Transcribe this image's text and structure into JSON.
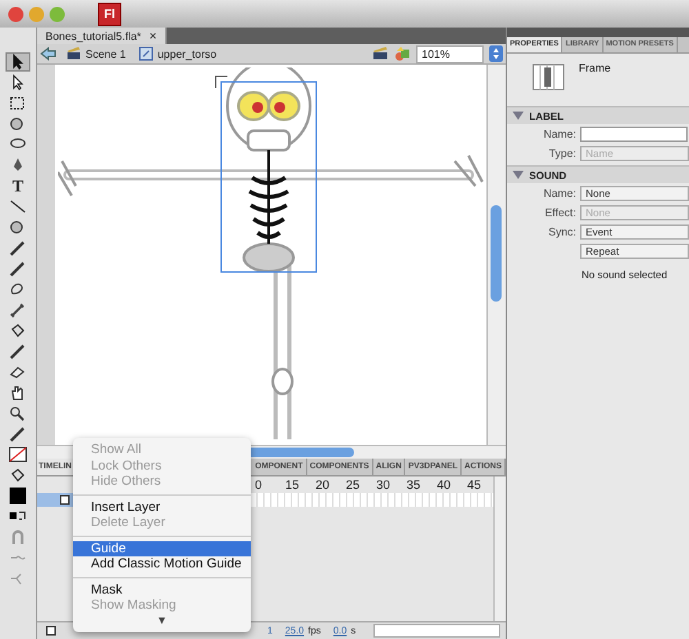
{
  "app_icon": "Fl",
  "document_tab": {
    "title": "Bones_tutorial5.fla*",
    "close": "×"
  },
  "edit_bar": {
    "crumbs": [
      {
        "label": "Scene 1",
        "kind": "scene"
      },
      {
        "label": "upper_torso",
        "kind": "symbol"
      }
    ],
    "zoom": "101%"
  },
  "tools": [
    {
      "kind": "arrow",
      "selected": true
    },
    {
      "kind": "subselect",
      "selected": false
    },
    {
      "kind": "transform",
      "selected": false
    },
    {
      "kind": "sphere",
      "selected": false
    },
    {
      "kind": "lasso",
      "selected": false
    },
    {
      "kind": "pen",
      "selected": false
    },
    {
      "kind": "text",
      "glyph": "T",
      "selected": false
    },
    {
      "kind": "line",
      "selected": false
    },
    {
      "kind": "oval",
      "selected": false
    },
    {
      "kind": "pencil",
      "selected": false
    },
    {
      "kind": "brush",
      "selected": false
    },
    {
      "kind": "deco",
      "selected": false
    },
    {
      "kind": "bone",
      "selected": false
    },
    {
      "kind": "bucket",
      "selected": false
    },
    {
      "kind": "eyedropper",
      "selected": false
    },
    {
      "kind": "eraser",
      "selected": false
    },
    {
      "kind": "hand",
      "selected": false
    },
    {
      "kind": "zoom",
      "selected": false
    },
    {
      "kind": "stroke",
      "selected": false
    },
    {
      "kind": "nostroke",
      "selected": false
    },
    {
      "kind": "bucket",
      "selected": false
    },
    {
      "kind": "fill",
      "selected": false
    },
    {
      "kind": "swap",
      "selected": false
    },
    {
      "kind": "magnet",
      "selected": false
    },
    {
      "kind": "smooth",
      "selected": false
    },
    {
      "kind": "straighten",
      "selected": false
    }
  ],
  "properties": {
    "tabs": [
      {
        "label": "PROPERTIES",
        "selected": true
      },
      {
        "label": "LIBRARY",
        "selected": false
      },
      {
        "label": "MOTION PRESETS",
        "selected": false
      }
    ],
    "object": "Frame",
    "sections": [
      {
        "title": "LABEL",
        "expanded": true,
        "rows": [
          {
            "label": "Name:",
            "kind": "input",
            "value": ""
          },
          {
            "label": "Type:",
            "kind": "select",
            "value": "Name",
            "disabled": true
          }
        ]
      },
      {
        "title": "SOUND",
        "expanded": true,
        "rows": [
          {
            "label": "Name:",
            "kind": "select",
            "value": "None",
            "disabled": false
          },
          {
            "label": "Effect:",
            "kind": "select",
            "value": "None",
            "disabled": true
          },
          {
            "label": "Sync:",
            "kind": "select",
            "value": "Event",
            "disabled": false
          },
          {
            "label": "",
            "kind": "select",
            "value": "Repeat",
            "disabled": false
          }
        ]
      }
    ],
    "note": "No sound selected"
  },
  "timeline": {
    "tabs": [
      {
        "label": "TIMELIN",
        "selected": true
      },
      {
        "label": "OMPONENT",
        "selected": false
      },
      {
        "label": "COMPONENTS",
        "selected": false
      },
      {
        "label": "ALIGN",
        "selected": false
      },
      {
        "label": "PV3DPANEL",
        "selected": false
      },
      {
        "label": "ACTIONS",
        "selected": false
      }
    ],
    "frame_numbers": [
      "0",
      "15",
      "20",
      "25",
      "30",
      "35",
      "40",
      "45"
    ],
    "status": {
      "frame": "1",
      "fps": "25.0",
      "fps_unit": "fps",
      "time": "0.0",
      "time_unit": "s"
    }
  },
  "context_menu": {
    "items": [
      {
        "kind": "item",
        "label": "Show All",
        "disabled": true,
        "selected": false
      },
      {
        "kind": "item",
        "label": "Lock Others",
        "disabled": true,
        "selected": false
      },
      {
        "kind": "item",
        "label": "Hide Others",
        "disabled": true,
        "selected": false
      },
      {
        "kind": "separator"
      },
      {
        "kind": "item",
        "label": "Insert Layer",
        "disabled": false,
        "selected": false
      },
      {
        "kind": "item",
        "label": "Delete Layer",
        "disabled": true,
        "selected": false
      },
      {
        "kind": "separator"
      },
      {
        "kind": "item",
        "label": "Guide",
        "disabled": false,
        "selected": true
      },
      {
        "kind": "item",
        "label": "Add Classic Motion Guide",
        "disabled": false,
        "selected": false
      },
      {
        "kind": "separator"
      },
      {
        "kind": "item",
        "label": "Mask",
        "disabled": false,
        "selected": false
      },
      {
        "kind": "item",
        "label": "Show Masking",
        "disabled": true,
        "selected": false
      }
    ],
    "more": "▼"
  }
}
